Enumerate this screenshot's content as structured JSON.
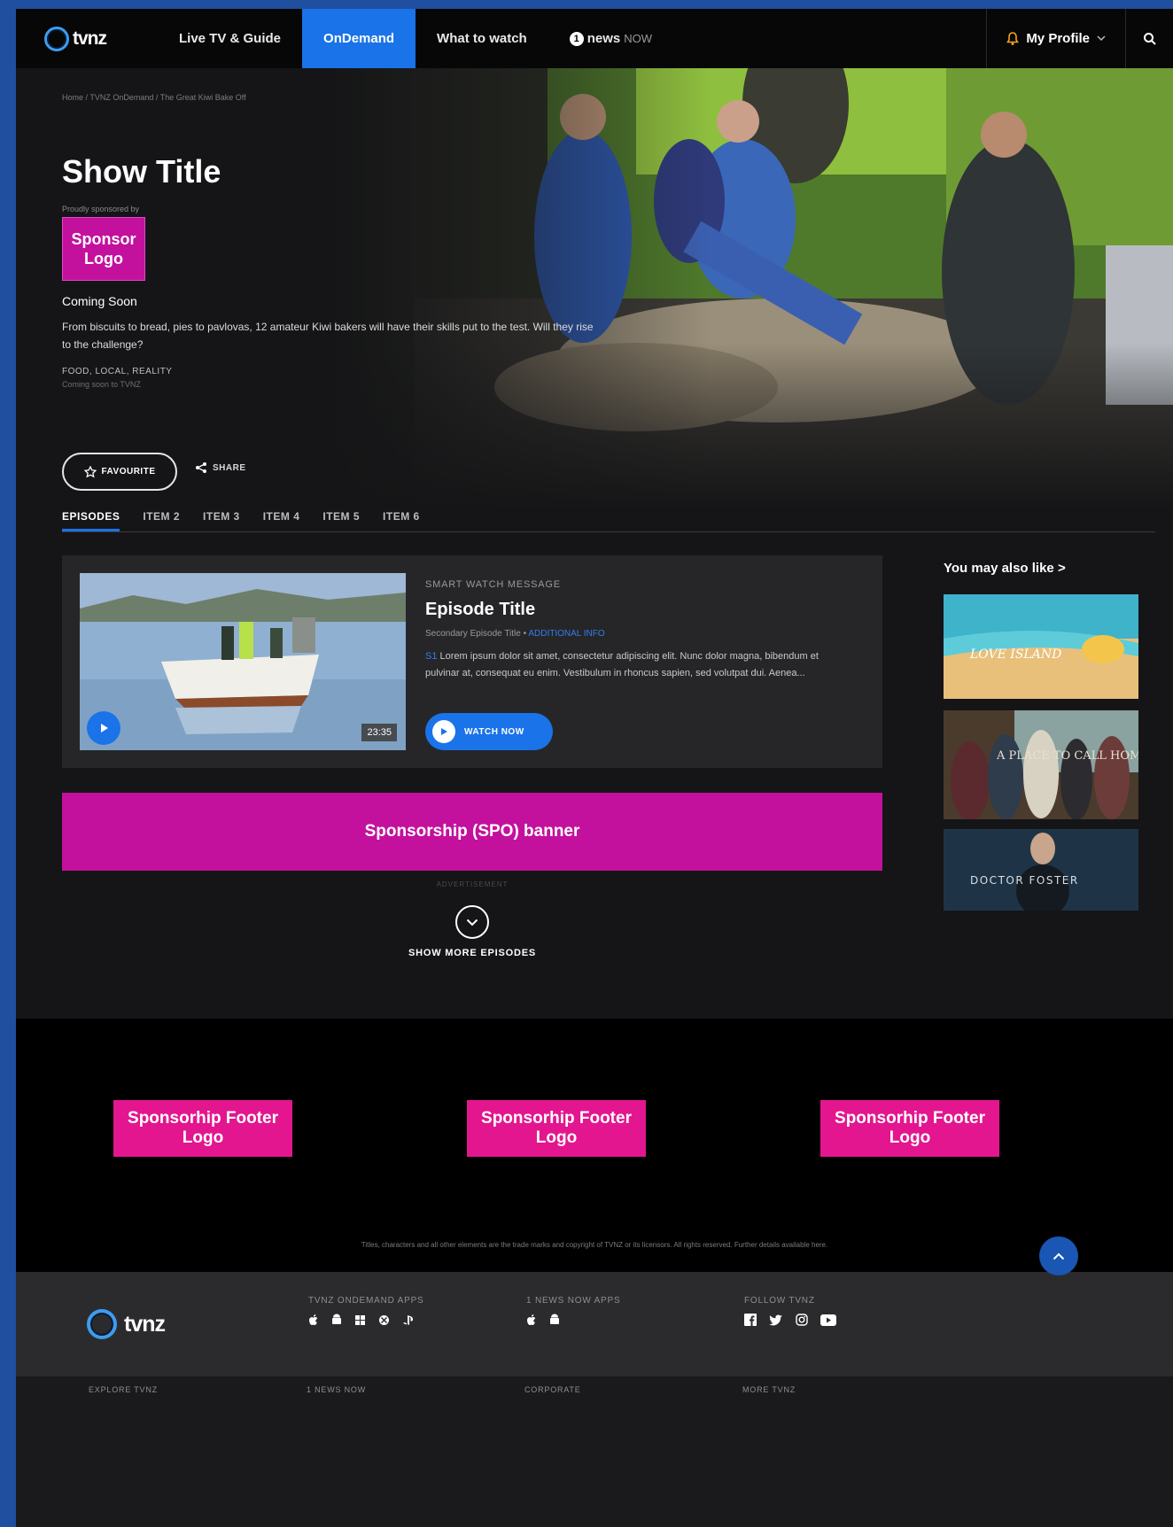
{
  "nav": {
    "logo": "tvnz",
    "items": [
      "Live TV & Guide",
      "OnDemand",
      "What to watch"
    ],
    "news_one": "1",
    "news_word": "news",
    "news_now": "NOW",
    "profile": "My Profile"
  },
  "hero": {
    "breadcrumb": "Home / TVNZ OnDemand / The Great Kiwi Bake Off",
    "title": "Show Title",
    "sponsored_by": "Proudly sponsored by",
    "sponsor_logo": "Sponsor Logo",
    "status": "Coming Soon",
    "description": "From biscuits to bread, pies to pavlovas, 12 amateur Kiwi bakers will have their skills put to the test. Will they rise to the challenge?",
    "genres": "FOOD, LOCAL, REALITY",
    "availability": "Coming soon to TVNZ",
    "favourite_label": "FAVOURITE",
    "share_label": "SHARE"
  },
  "tabs": [
    "EPISODES",
    "ITEM 2",
    "ITEM 3",
    "ITEM 4",
    "ITEM 5",
    "ITEM 6"
  ],
  "episode": {
    "smart_message": "SMART WATCH MESSAGE",
    "title": "Episode Title",
    "secondary": "Secondary Episode Title",
    "secondary_link": "ADDITIONAL INFO",
    "desc_prefix": "S1",
    "description": "Lorem ipsum dolor sit amet, consectetur adipiscing elit. Nunc dolor magna, bibendum et pulvinar at, consequat eu enim. Vestibulum in rhoncus sapien, sed volutpat dui. Aenea...",
    "duration": "23:35",
    "watch_label": "WATCH NOW"
  },
  "spo_banner": "Sponsorship (SPO) banner",
  "ad_label": "ADVERTISEMENT",
  "show_more": "SHOW MORE EPISODES",
  "you_may_also_like": "You may also like >",
  "recommendations": [
    {
      "label": "LOVE ISLAND"
    },
    {
      "label": "A PLACE TO CALL HOME"
    },
    {
      "label": "DOCTOR FOSTER"
    }
  ],
  "footer": {
    "sponsor_logos": [
      "Sponsorhip Footer Logo",
      "Sponsorhip Footer Logo",
      "Sponsorhip Footer Logo"
    ],
    "copyright": "Titles, characters and all other elements are the trade marks and copyright of TVNZ or its licensors. All rights reserved. Further details available here.",
    "logo": "tvnz",
    "col_titles": [
      "TVNZ ONDEMAND APPS",
      "1 NEWS NOW APPS",
      "FOLLOW TVNZ"
    ],
    "link_titles": [
      "EXPLORE TVNZ",
      "1 NEWS NOW",
      "CORPORATE",
      "MORE TVNZ"
    ]
  },
  "colors": {
    "accent_blue": "#1a73e8",
    "sponsor_magenta": "#c3119e",
    "footer_logo_pink": "#e3168f"
  }
}
